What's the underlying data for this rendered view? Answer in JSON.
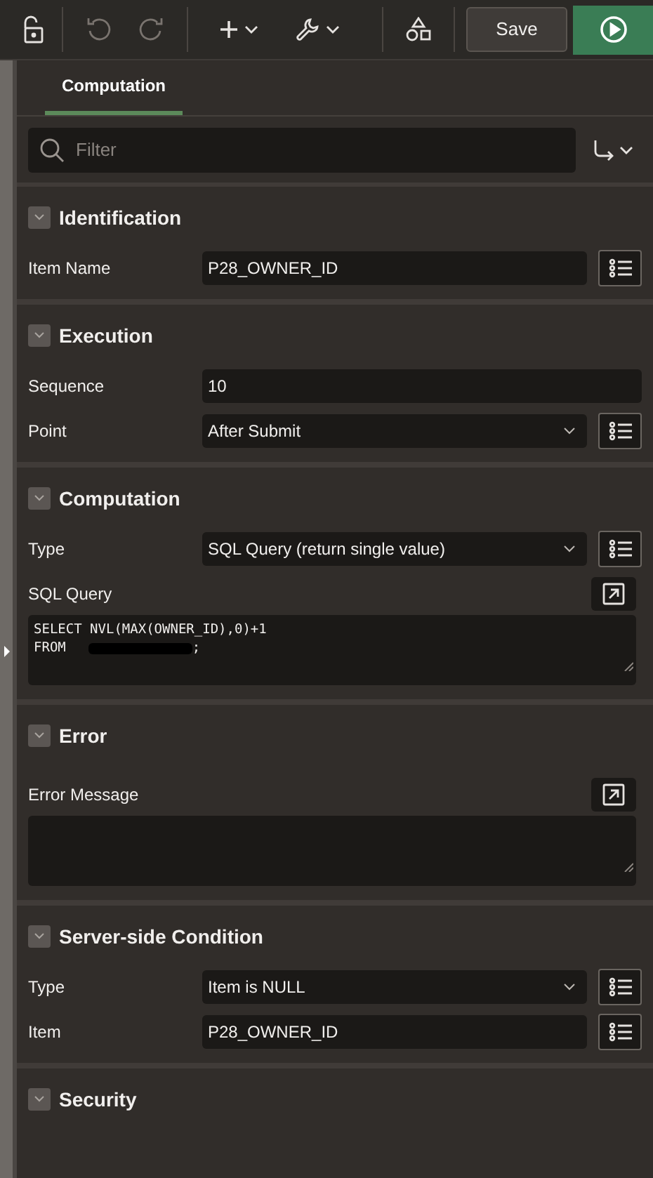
{
  "toolbar": {
    "save_label": "Save",
    "undo_disabled": true,
    "redo_disabled": true
  },
  "tabs": [
    {
      "label": "Computation",
      "selected": true
    }
  ],
  "filter": {
    "placeholder": "Filter"
  },
  "sections": [
    {
      "title": "Identification",
      "expanded": true,
      "rows": [
        {
          "kind": "text",
          "label": "Item Name",
          "value": "P28_OWNER_ID",
          "lov": true
        }
      ]
    },
    {
      "title": "Execution",
      "expanded": true,
      "rows": [
        {
          "kind": "text",
          "label": "Sequence",
          "value": "10",
          "lov": false
        },
        {
          "kind": "select",
          "label": "Point",
          "value": "After Submit",
          "lov": true
        }
      ]
    },
    {
      "title": "Computation",
      "expanded": true,
      "rows": [
        {
          "kind": "select",
          "label": "Type",
          "value": "SQL Query (return single value)",
          "lov": true
        },
        {
          "kind": "editor",
          "label": "SQL Query",
          "code": [
            {
              "text": "SELECT NVL(MAX(OWNER_ID),0)+1",
              "redacted": false
            },
            {
              "text": "FROM",
              "redacted": true,
              "after": ";"
            }
          ]
        }
      ]
    },
    {
      "title": "Error",
      "expanded": true,
      "rows": [
        {
          "kind": "editor",
          "label": "Error Message"
        }
      ]
    },
    {
      "title": "Server-side Condition",
      "expanded": true,
      "rows": [
        {
          "kind": "select",
          "label": "Type",
          "value": "Item is NULL",
          "lov": true
        },
        {
          "kind": "text",
          "label": "Item",
          "value": "P28_OWNER_ID",
          "lov": true
        }
      ]
    },
    {
      "title": "Security",
      "expanded": true
    }
  ]
}
